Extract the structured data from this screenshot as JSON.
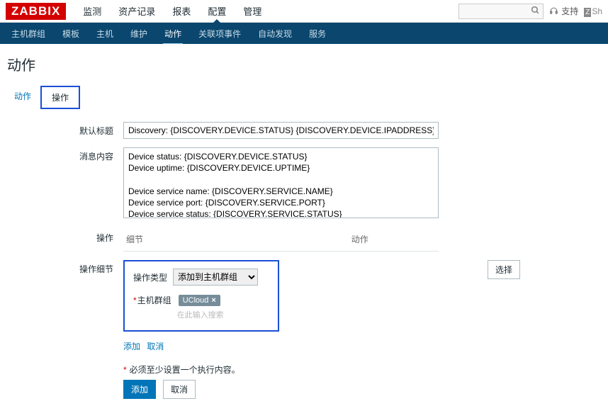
{
  "logo": "ZABBIX",
  "main_nav": [
    "监测",
    "资产记录",
    "报表",
    "配置",
    "管理"
  ],
  "main_nav_active": 3,
  "search_placeholder": "",
  "support_label": "支持",
  "share_label": "Sh",
  "sub_nav": [
    "主机群组",
    "模板",
    "主机",
    "维护",
    "动作",
    "关联项事件",
    "自动发现",
    "服务"
  ],
  "sub_nav_active": 4,
  "page_title": "动作",
  "tabs": [
    "动作",
    "操作"
  ],
  "tab_active": 1,
  "form": {
    "default_subject_label": "默认标题",
    "default_subject_value": "Discovery: {DISCOVERY.DEVICE.STATUS} {DISCOVERY.DEVICE.IPADDRESS}",
    "default_message_label": "消息内容",
    "default_message_value": "Device status: {DISCOVERY.DEVICE.STATUS}\nDevice uptime: {DISCOVERY.DEVICE.UPTIME}\n\nDevice service name: {DISCOVERY.SERVICE.NAME}\nDevice service port: {DISCOVERY.SERVICE.PORT}\nDevice service status: {DISCOVERY.SERVICE.STATUS}\nDevice service uptime: {DISCOVERY.SERVICE.UPTIME}",
    "operations_label": "操作",
    "op_header_detail": "细节",
    "op_header_action": "动作",
    "operation_detail_label": "操作细节",
    "operation_type_label": "操作类型",
    "operation_type_value": "添加到主机群组",
    "host_group_label": "主机群组",
    "host_group_chip": "UCloud",
    "host_group_placeholder": "在此输入搜索",
    "select_button": "选择",
    "add_link": "添加",
    "cancel_link": "取消",
    "hint": "必须至少设置一个执行内容。",
    "submit_add": "添加",
    "submit_cancel": "取消"
  }
}
